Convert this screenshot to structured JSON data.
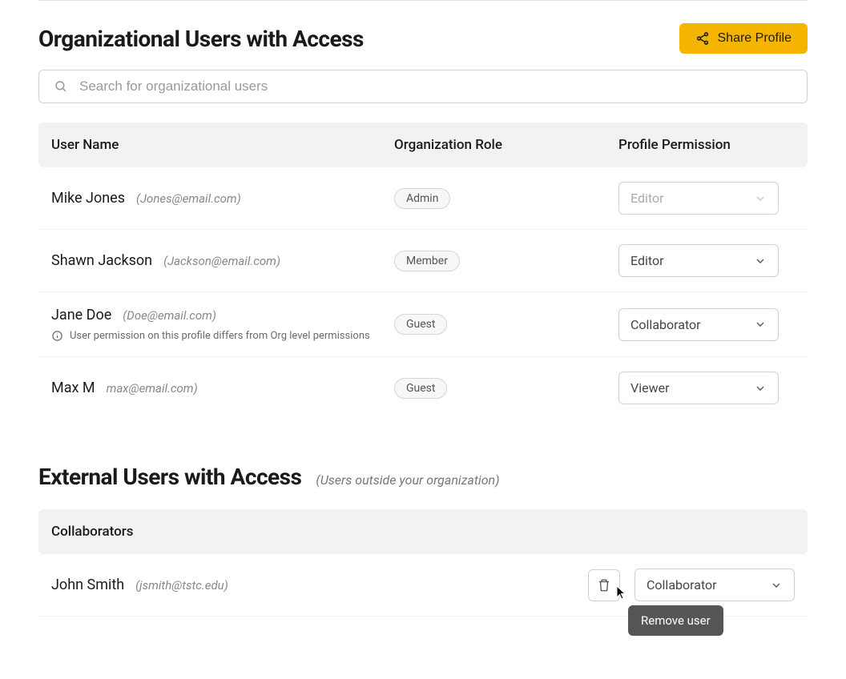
{
  "org_section": {
    "title": "Organizational Users with Access",
    "share_button_label": "Share Profile",
    "search_placeholder": "Search for organizational users",
    "columns": {
      "username": "User Name",
      "org_role": "Organization Role",
      "profile_permission": "Profile Permission"
    },
    "rows": [
      {
        "name": "Mike Jones",
        "email": "(Jones@email.com)",
        "role": "Admin",
        "permission": "Editor",
        "permission_disabled": true
      },
      {
        "name": "Shawn Jackson",
        "email": "(Jackson@email.com)",
        "role": "Member",
        "permission": "Editor",
        "permission_disabled": false
      },
      {
        "name": "Jane Doe",
        "email": "(Doe@email.com)",
        "role": "Guest",
        "permission": "Collaborator",
        "permission_disabled": false,
        "note": "User permission on this profile differs from Org level permissions"
      },
      {
        "name": "Max M",
        "email": "max@email.com)",
        "role": "Guest",
        "permission": "Viewer",
        "permission_disabled": false
      }
    ]
  },
  "external_section": {
    "title": "External Users with Access",
    "subtitle": "(Users outside your organization)",
    "collaborators_label": "Collaborators",
    "rows": [
      {
        "name": "John Smith",
        "email": "(jsmith@tstc.edu)",
        "permission": "Collaborator"
      }
    ]
  },
  "tooltip_text": "Remove user"
}
